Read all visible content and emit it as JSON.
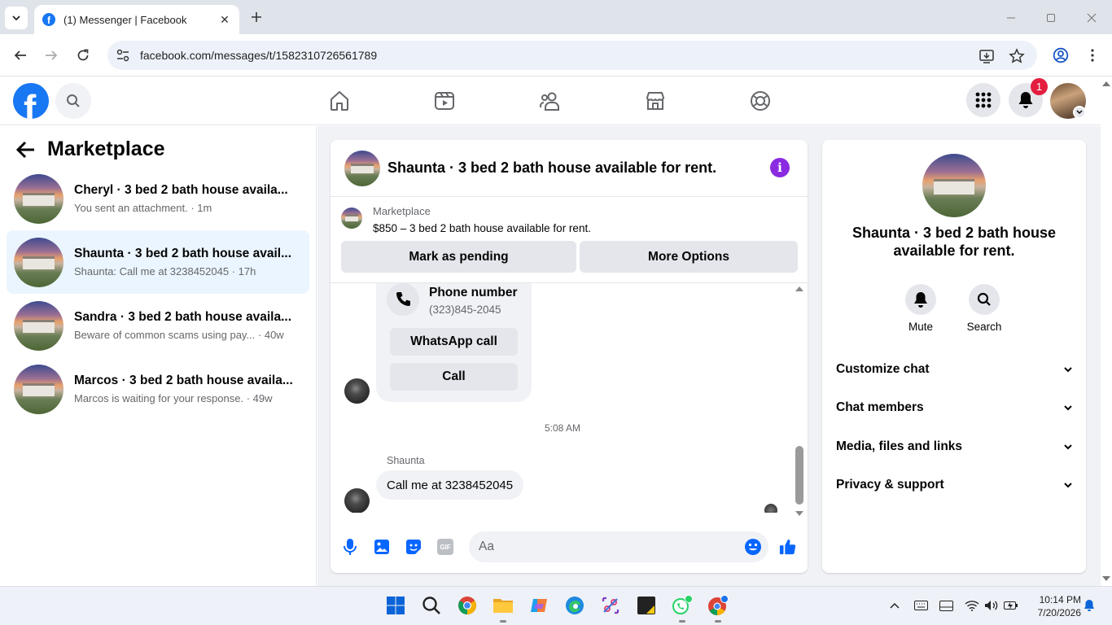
{
  "browser": {
    "tab_title": "(1) Messenger | Facebook",
    "favicon_letter": "f",
    "url": "facebook.com/messages/t/1582310726561789"
  },
  "facebook": {
    "logo_letter": "f",
    "notification_count": "1"
  },
  "left_panel": {
    "title": "Marketplace",
    "conversations": [
      {
        "name": "Cheryl · 3 bed 2 bath house availa...",
        "preview": "You sent an attachment. · 1m"
      },
      {
        "name": "Shaunta · 3 bed 2 bath house avail...",
        "preview": "Shaunta: Call me at 3238452045 · 17h"
      },
      {
        "name": "Sandra · 3 bed 2 bath house availa...",
        "preview": "Beware of common scams using pay... · 40w"
      },
      {
        "name": "Marcos · 3 bed 2 bath house availa...",
        "preview": "Marcos is waiting for your response. · 49w"
      }
    ]
  },
  "chat": {
    "header_title": "Shaunta · 3 bed 2 bath house available for rent.",
    "info_icon_glyph": "i",
    "listing_source": "Marketplace",
    "listing_price": "$850 – 3 bed 2 bath house available for rent.",
    "mark_pending_label": "Mark as pending",
    "more_options_label": "More Options",
    "phone_card": {
      "label": "Phone number",
      "number": "(323)845-2045",
      "whatsapp_label": "WhatsApp call",
      "call_label": "Call"
    },
    "timestamp": "5:08 AM",
    "sender": "Shaunta",
    "message": "Call me at 3238452045",
    "composer_placeholder": "Aa",
    "gif_label": "GIF"
  },
  "details": {
    "name": "Shaunta · 3 bed 2 bath house available for rent.",
    "mute_label": "Mute",
    "search_label": "Search",
    "sections": [
      "Customize chat",
      "Chat members",
      "Media, files and links",
      "Privacy & support"
    ]
  },
  "taskbar": {
    "time": "10:14 PM",
    "date": "7/20/2026"
  },
  "colors": {
    "brand": "#1877f2",
    "active_row": "#ebf5ff",
    "info_icon": "#8a2be2",
    "badge": "#e41e3f"
  }
}
